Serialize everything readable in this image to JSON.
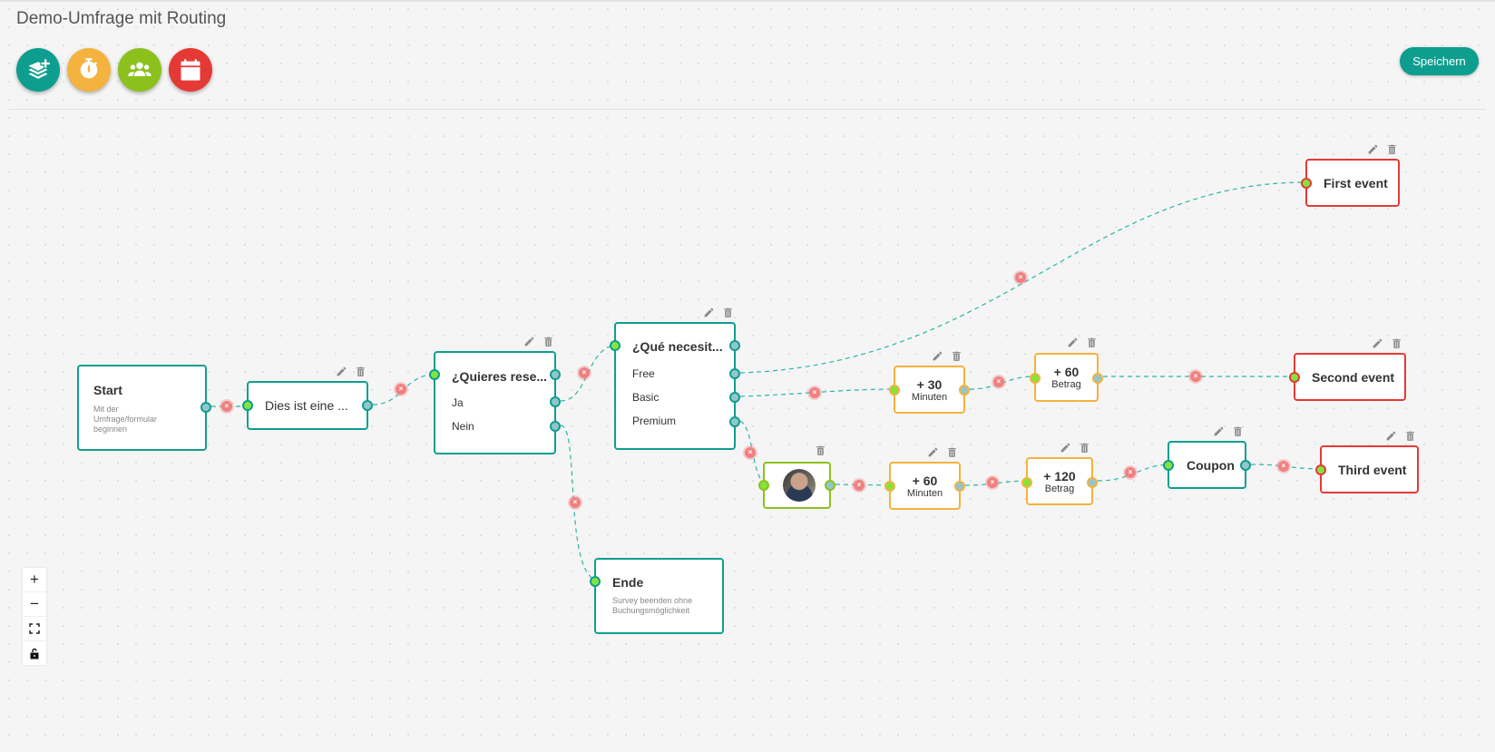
{
  "header": {
    "title": "Demo-Umfrage mit Routing",
    "save_label": "Speichern",
    "actions": [
      {
        "name": "add-question-button",
        "icon": "layers-plus-icon",
        "color": "#0e9e8f"
      },
      {
        "name": "add-duration-button",
        "icon": "stopwatch-icon",
        "color": "#f4b23e"
      },
      {
        "name": "add-staff-button",
        "icon": "users-icon",
        "color": "#8cc11d"
      },
      {
        "name": "add-event-button",
        "icon": "calendar-icon",
        "color": "#e53935"
      }
    ]
  },
  "colors": {
    "accent": "#0e9e8f",
    "duration": "#f4b23e",
    "event": "#e53935",
    "staff": "#8cc11d",
    "edge_delete": "#f08080"
  },
  "nodes": {
    "start": {
      "title": "Start",
      "subtitle": "Mit der Umfrage/formular beginnen"
    },
    "intro": {
      "title": "Dies ist eine ..."
    },
    "q1": {
      "title": "¿Quieres rese...",
      "options": [
        "Ja",
        "Nein"
      ]
    },
    "q2": {
      "title": "¿Qué necesit...",
      "options": [
        "Free",
        "Basic",
        "Premium"
      ]
    },
    "end": {
      "title": "Ende",
      "subtitle": "Survey beenden ohne Buchungsmöglichkeit"
    },
    "dur30": {
      "value": "+ 30",
      "unit": "Minuten"
    },
    "amt60": {
      "value": "+ 60",
      "unit": "Betrag"
    },
    "dur60": {
      "value": "+ 60",
      "unit": "Minuten"
    },
    "amt120": {
      "value": "+ 120",
      "unit": "Betrag"
    },
    "coupon": {
      "title": "Coupon"
    },
    "ev1": {
      "title": "First event"
    },
    "ev2": {
      "title": "Second event"
    },
    "ev3": {
      "title": "Third event"
    },
    "staff": {
      "avatar": "staff-photo"
    }
  },
  "edge_delete_glyph": "×",
  "controls": {
    "zoom_in": "+",
    "zoom_out": "−",
    "fit": "⛶",
    "lock": "🔓"
  }
}
